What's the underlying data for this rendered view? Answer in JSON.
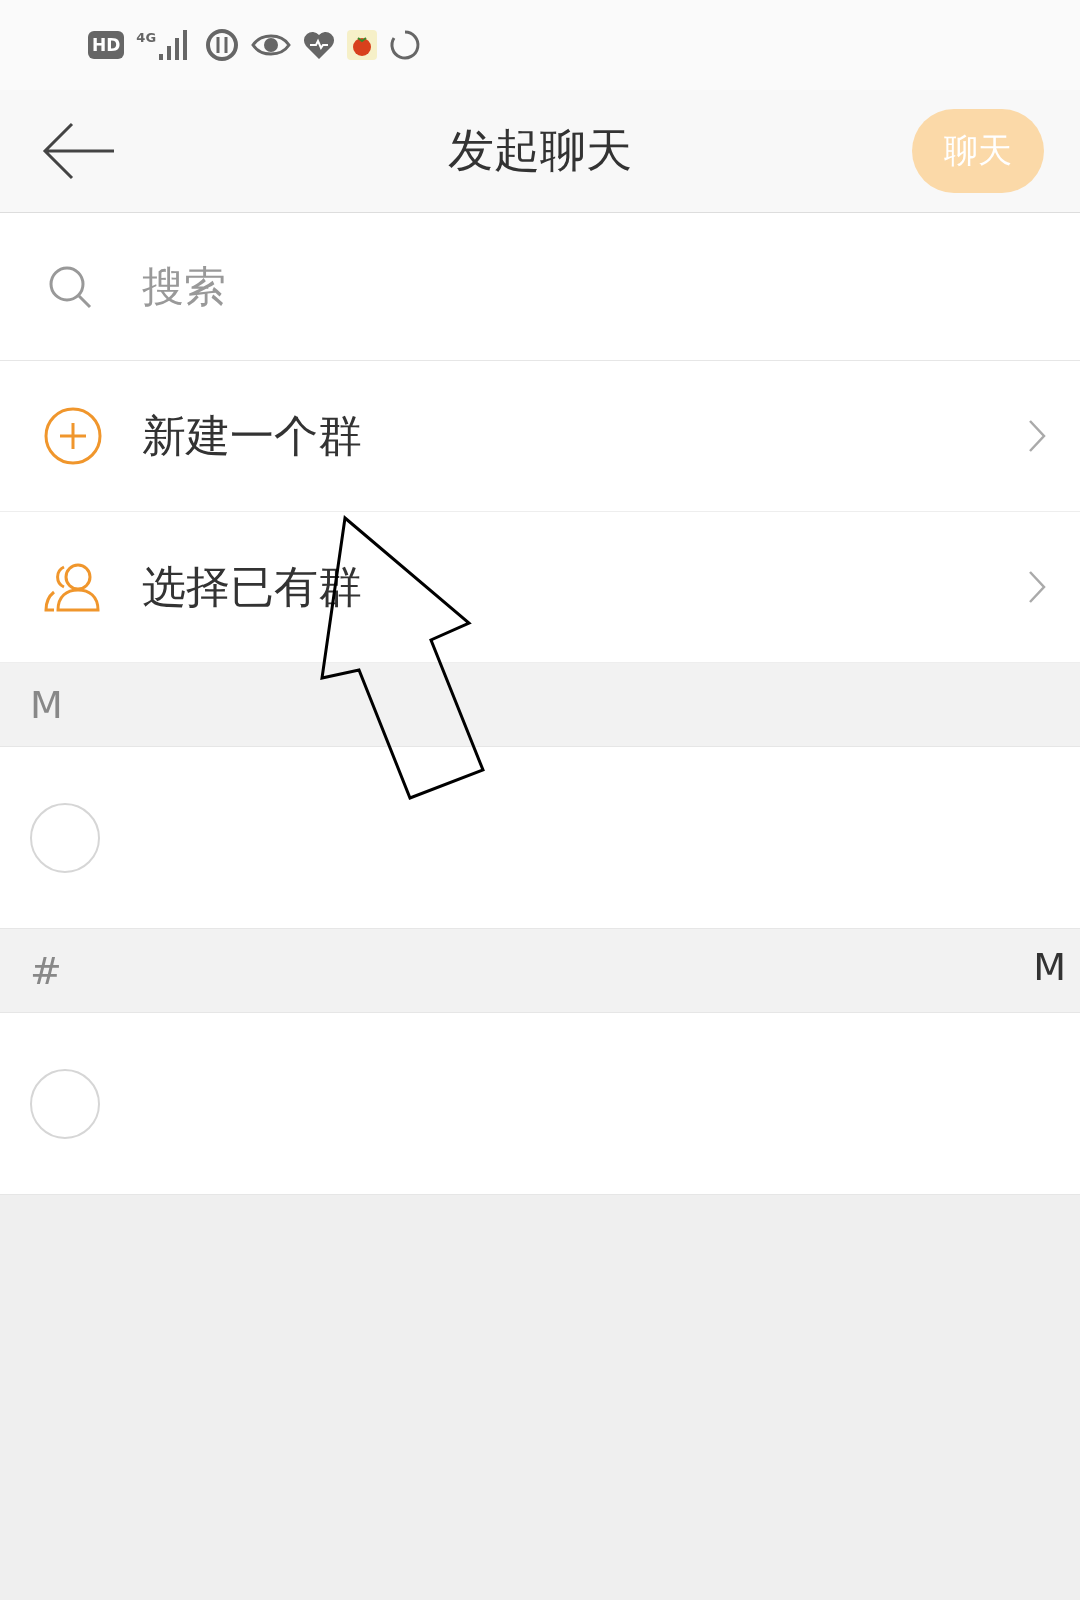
{
  "status_bar": {
    "hd": "HD",
    "network": "4G"
  },
  "header": {
    "title": "发起聊天",
    "action": {
      "label": "聊天",
      "disabled": true
    }
  },
  "search": {
    "placeholder": "搜索"
  },
  "menu": [
    {
      "kind": "new-group",
      "label": "新建一个群"
    },
    {
      "kind": "existing-group",
      "label": "选择已有群"
    }
  ],
  "sections": [
    {
      "letter": "M",
      "contacts": [
        {
          "checked": false
        }
      ]
    },
    {
      "letter": "#",
      "contacts": [
        {
          "checked": false
        }
      ]
    }
  ],
  "index_bar": [
    "M"
  ]
}
